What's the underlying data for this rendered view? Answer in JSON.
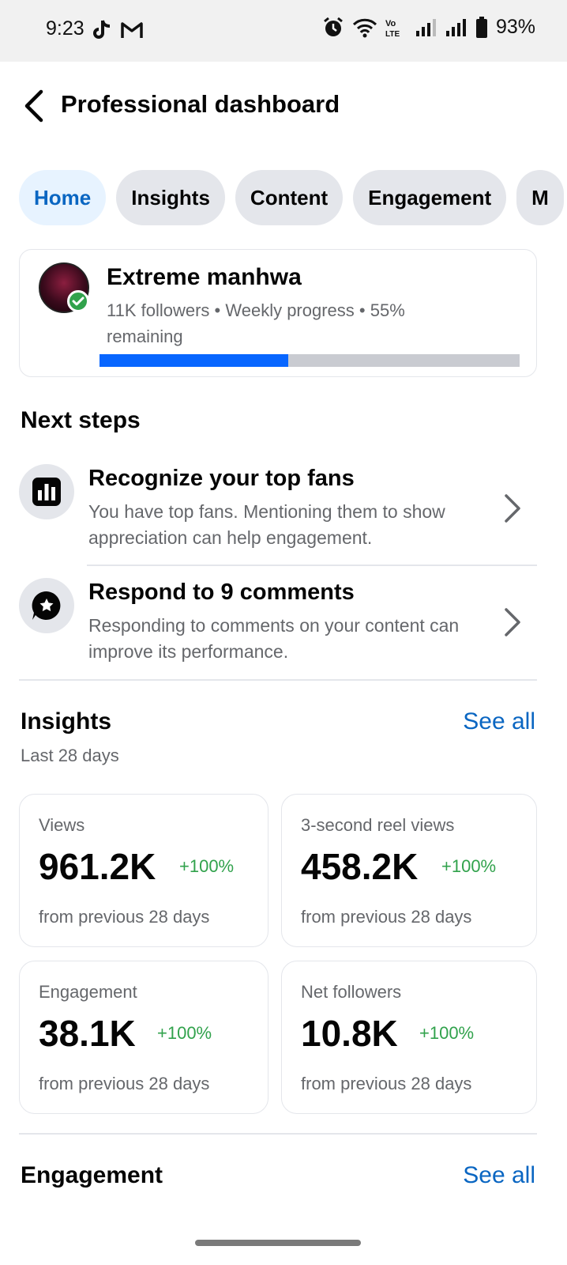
{
  "status_bar": {
    "time": "9:23",
    "battery": "93%",
    "icons": [
      "tiktok-icon",
      "gmail-icon",
      "alarm-icon",
      "wifi-icon",
      "volte-icon",
      "signal-icon",
      "signal-icon",
      "battery-icon"
    ]
  },
  "header": {
    "title": "Professional dashboard",
    "back_icon": "chevron-left-icon"
  },
  "tabs": [
    {
      "label": "Home",
      "active": true
    },
    {
      "label": "Insights",
      "active": false
    },
    {
      "label": "Content",
      "active": false
    },
    {
      "label": "Engagement",
      "active": false
    },
    {
      "label": "M",
      "active": false
    }
  ],
  "profile": {
    "name": "Extreme manhwa",
    "meta": "11K followers • Weekly progress • 55% remaining",
    "progress": 0.45,
    "verified": true
  },
  "next_steps": {
    "title": "Next steps",
    "items": [
      {
        "icon": "bar-chart-icon",
        "title": "Recognize your top fans",
        "description": "You have top fans. Mentioning them to show appreciation can help engagement."
      },
      {
        "icon": "comment-star-icon",
        "title": "Respond to 9 comments",
        "description": "Responding to comments on your content can improve its performance."
      }
    ]
  },
  "insights": {
    "title": "Insights",
    "see_all": "See all",
    "period": "Last 28 days",
    "cards": [
      {
        "label": "Views",
        "value": "961.2K",
        "change": "+100%",
        "footnote": "from previous 28 days"
      },
      {
        "label": "3-second reel views",
        "value": "458.2K",
        "change": "+100%",
        "footnote": "from previous 28 days"
      },
      {
        "label": "Engagement",
        "value": "38.1K",
        "change": "+100%",
        "footnote": "from previous 28 days"
      },
      {
        "label": "Net followers",
        "value": "10.8K",
        "change": "+100%",
        "footnote": "from previous 28 days"
      }
    ]
  },
  "engagement": {
    "title": "Engagement",
    "see_all": "See all"
  },
  "colors": {
    "accent": "#0a66c2",
    "progress": "#0866ff",
    "positive": "#31a24c",
    "muted": "#65676b"
  }
}
